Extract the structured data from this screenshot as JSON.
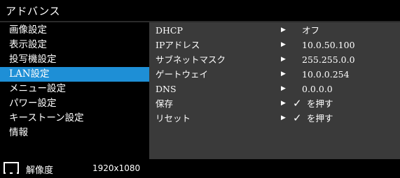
{
  "title": "アドバンス",
  "sidebar": {
    "items": [
      {
        "label": "画像設定"
      },
      {
        "label": "表示設定"
      },
      {
        "label": "投写機設定"
      },
      {
        "label": "LAN設定"
      },
      {
        "label": "メニュー設定"
      },
      {
        "label": "パワー設定"
      },
      {
        "label": "キーストーン設定"
      },
      {
        "label": "情報"
      }
    ],
    "active_index": 3
  },
  "panel": {
    "rows": [
      {
        "label": "DHCP",
        "value": "オフ"
      },
      {
        "label": "IPアドレス",
        "value": "10.0.50.100"
      },
      {
        "label": "サブネットマスク",
        "value": "255.255.0.0"
      },
      {
        "label": "ゲートウェイ",
        "value": "10.0.0.254"
      },
      {
        "label": "DNS",
        "value": "0.0.0.0"
      },
      {
        "label": "保存",
        "value": "を押す"
      },
      {
        "label": "リセット",
        "value": "を押す"
      }
    ],
    "arrow_glyph": "▶",
    "check_glyph": "✓"
  },
  "footer": {
    "resolution_label": "解像度",
    "resolution_value": "1920x1080"
  },
  "colors": {
    "highlight": "#1e8fd6",
    "panel_bg": "#3a3a3a",
    "sidebar_bg": "#000000"
  }
}
